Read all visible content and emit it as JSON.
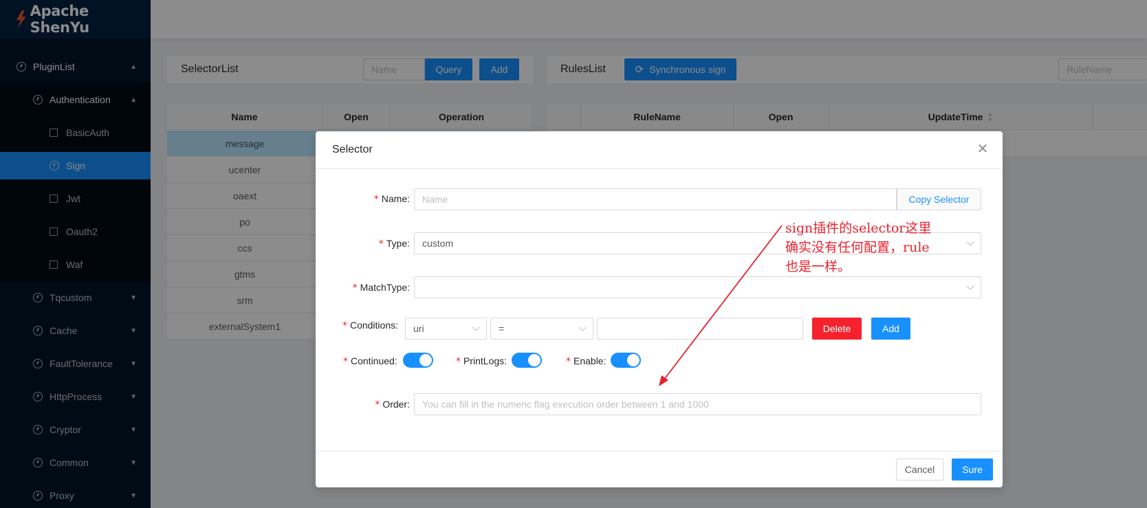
{
  "app": {
    "title": "Apache ShenYu"
  },
  "sidebar": {
    "items": [
      {
        "label": "PluginList",
        "icon": "dashboard-icon",
        "expanded": true
      },
      {
        "label": "Authentication",
        "icon": "dashboard-icon",
        "expanded": true
      },
      {
        "label": "BasicAuth",
        "icon": "plugin-icon"
      },
      {
        "label": "Sign",
        "icon": "plugin-icon",
        "active": true
      },
      {
        "label": "Jwt",
        "icon": "plugin-icon"
      },
      {
        "label": "Oauth2",
        "icon": "plugin-icon"
      },
      {
        "label": "Waf",
        "icon": "plugin-icon"
      },
      {
        "label": "Tqcustom",
        "icon": "dashboard-icon"
      },
      {
        "label": "Cache",
        "icon": "dashboard-icon"
      },
      {
        "label": "FaultTolerance",
        "icon": "dashboard-icon"
      },
      {
        "label": "HttpProcess",
        "icon": "dashboard-icon"
      },
      {
        "label": "Cryptor",
        "icon": "dashboard-icon"
      },
      {
        "label": "Common",
        "icon": "dashboard-icon"
      },
      {
        "label": "Proxy",
        "icon": "dashboard-icon"
      }
    ]
  },
  "selector_panel": {
    "title": "SelectorList",
    "search_placeholder": "Name",
    "query_label": "Query",
    "add_label": "Add",
    "columns": [
      "Name",
      "Open",
      "Operation"
    ],
    "rows": [
      "message",
      "ucenter",
      "oaext",
      "po",
      "ccs",
      "gtms",
      "srm",
      "externalSystem1"
    ]
  },
  "rules_panel": {
    "title": "RulesList",
    "sync_label": "Synchronous sign",
    "search_placeholder": "RuleName",
    "columns": [
      "RuleName",
      "Open",
      "UpdateTime"
    ]
  },
  "modal": {
    "title": "Selector",
    "name_label": "Name:",
    "name_placeholder": "Name",
    "copy_selector_label": "Copy Selector",
    "type_label": "Type:",
    "type_value": "custom",
    "matchtype_label": "MatchType:",
    "matchtype_value": "",
    "conditions_label": "Conditions:",
    "condition_param": "uri",
    "condition_operator": "=",
    "condition_value": "",
    "delete_label": "Delete",
    "add_label": "Add",
    "continued_label": "Continued:",
    "printlogs_label": "PrintLogs:",
    "enable_label": "Enable:",
    "order_label": "Order:",
    "order_placeholder": "You can fill in the numeric flag execution order between 1 and 1000",
    "cancel_label": "Cancel",
    "sure_label": "Sure",
    "switches": {
      "continued": true,
      "printlogs": true,
      "enable": true
    }
  },
  "annotation": {
    "lines": [
      "sign插件的selector这里",
      "确实没有任何配置，rule",
      "也是一样。"
    ],
    "color": "#e8222d"
  },
  "colors": {
    "primary": "#1890ff",
    "danger": "#f5222d",
    "sidebar": "#001529"
  }
}
